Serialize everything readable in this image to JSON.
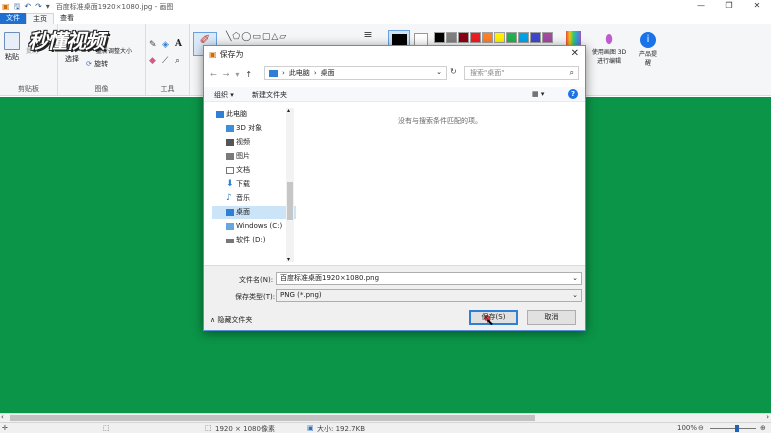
{
  "titlebar": {
    "title": "百度标准桌面1920×1080.jpg - 画图",
    "save_icon": "save-icon",
    "undo_icon": "undo-icon",
    "redo_icon": "redo-icon",
    "minimize": "—",
    "maximize": "❐",
    "close": "✕"
  },
  "ribbon_tabs": {
    "file": "文件",
    "home": "主页",
    "view": "查看"
  },
  "ribbon": {
    "paste": "粘贴",
    "cut": "剪切",
    "copy": "复制",
    "select": "选择",
    "resize": "重新调整大小",
    "rotate": "旋转",
    "clipboard_label": "剪贴板",
    "image_label": "图像",
    "tools_label": "工具",
    "paint3d": "使用画图 3D 进行编辑",
    "product_alert": "产品提醒",
    "colors": [
      "#000000",
      "#7f7f7f",
      "#880015",
      "#ed1c24",
      "#ff7f27",
      "#fff200",
      "#22b14c",
      "#00a2e8",
      "#3f48cc",
      "#a349a4"
    ]
  },
  "watermark": "秒懂视频",
  "dialog": {
    "title": "保存为",
    "close": "✕",
    "breadcrumb": [
      "此电脑",
      "桌面"
    ],
    "search_placeholder": "搜索\"桌面\"",
    "organize": "组织 ▾",
    "new_folder": "新建文件夹",
    "empty_message": "没有与搜索条件匹配的项。",
    "sidebar": [
      "此电脑",
      "3D 对象",
      "视频",
      "图片",
      "文档",
      "下载",
      "音乐",
      "桌面",
      "Windows (C:)",
      "软件 (D:)"
    ],
    "filename_label": "文件名(N):",
    "filename_value": "百度标准桌面1920×1080.png",
    "filetype_label": "保存类型(T):",
    "filetype_value": "PNG (*.png)",
    "hide_folders": "隐藏文件夹",
    "save_button": "保存(S)",
    "cancel_button": "取消"
  },
  "statusbar": {
    "dimensions": "1920 × 1080像素",
    "size": "大小: 192.7KB",
    "zoom": "100%"
  }
}
